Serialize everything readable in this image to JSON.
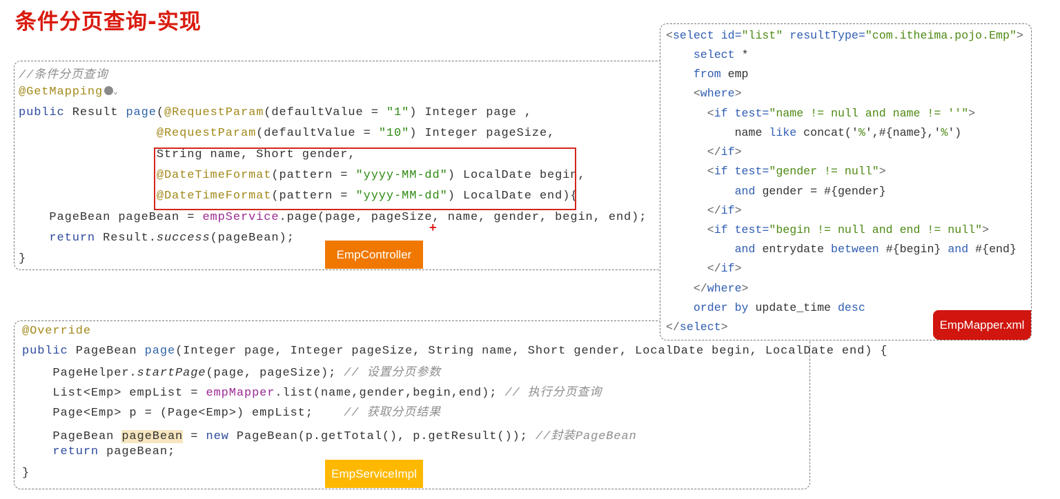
{
  "title": "条件分页查询-实现",
  "controller": {
    "label": "EmpController",
    "lines": [
      [
        [
          "//条件分页查询",
          "c"
        ]
      ],
      [
        [
          "@GetMapping",
          "a"
        ]
      ],
      [
        [
          "public ",
          "k"
        ],
        [
          "Result ",
          "t"
        ],
        [
          "page",
          "m"
        ],
        [
          "(",
          "t"
        ],
        [
          "@RequestParam",
          "a"
        ],
        [
          "(defaultValue = ",
          "t"
        ],
        [
          "\"1\"",
          "s"
        ],
        [
          ") Integer page ,",
          "t"
        ]
      ],
      [
        [
          "                  ",
          "t"
        ],
        [
          "@RequestParam",
          "a"
        ],
        [
          "(defaultValue = ",
          "t"
        ],
        [
          "\"10\"",
          "s"
        ],
        [
          ") Integer pageSize,",
          "t"
        ]
      ],
      [
        [
          "                  String name, Short gender,",
          "t"
        ]
      ],
      [
        [
          "                  ",
          "t"
        ],
        [
          "@DateTimeFormat",
          "a"
        ],
        [
          "(pattern = ",
          "t"
        ],
        [
          "\"yyyy-MM-dd\"",
          "s"
        ],
        [
          ") LocalDate begin,",
          "t"
        ]
      ],
      [
        [
          "                  ",
          "t"
        ],
        [
          "@DateTimeFormat",
          "a"
        ],
        [
          "(pattern = ",
          "t"
        ],
        [
          "\"yyyy-MM-dd\"",
          "s"
        ],
        [
          ") LocalDate end){",
          "t"
        ]
      ],
      [
        [
          "    PageBean pageBean = ",
          "t"
        ],
        [
          "empService",
          "f"
        ],
        [
          ".page(page, pageSize, name, gender, begin, end);",
          "t"
        ]
      ],
      [
        [
          "    ",
          "t"
        ],
        [
          "return ",
          "k"
        ],
        [
          "Result.",
          "t"
        ],
        [
          "success",
          "i"
        ],
        [
          "(pageBean);",
          "t"
        ]
      ],
      [
        [
          "}",
          "t"
        ]
      ]
    ]
  },
  "service": {
    "label": "EmpServiceImpl",
    "lines": [
      [
        [
          "@Override",
          "a"
        ]
      ],
      [
        [
          "public ",
          "k"
        ],
        [
          "PageBean ",
          "t"
        ],
        [
          "page",
          "m"
        ],
        [
          "(Integer page, Integer pageSize, String name, Short gender, LocalDate begin, LocalDate end) {",
          "t"
        ]
      ],
      [
        [
          "    PageHelper.",
          "t"
        ],
        [
          "startPage",
          "i"
        ],
        [
          "(page, pageSize); ",
          "t"
        ],
        [
          "// 设置分页参数",
          "c"
        ]
      ],
      [
        [
          "    List<Emp> empList = ",
          "t"
        ],
        [
          "empMapper",
          "f"
        ],
        [
          ".list(name,gender,begin,end); ",
          "t"
        ],
        [
          "// 执行分页查询",
          "c"
        ]
      ],
      [
        [
          "    Page<Emp> p = (Page<Emp>) empList;    ",
          "t"
        ],
        [
          "// 获取分页结果",
          "c"
        ]
      ],
      [
        [
          "    PageBean ",
          "t"
        ],
        [
          "pageBean",
          "h"
        ],
        [
          " = ",
          "t"
        ],
        [
          "new ",
          "k"
        ],
        [
          "PageBean(p.getTotal(), p.getResult()); ",
          "t"
        ],
        [
          "//封装PageBean",
          "c"
        ]
      ],
      [
        [
          "    ",
          "t"
        ],
        [
          "return ",
          "k"
        ],
        [
          "pageBean;",
          "t"
        ]
      ],
      [
        [
          "}",
          "t"
        ]
      ]
    ]
  },
  "mapper": {
    "label": "EmpMapper.xml",
    "lines": [
      [
        [
          "<",
          "tg"
        ],
        [
          "select ",
          "tn"
        ],
        [
          "id=",
          "an"
        ],
        [
          "\"list\" ",
          "av"
        ],
        [
          "resultType=",
          "an"
        ],
        [
          "\"com.itheima.pojo.Emp\"",
          "av"
        ],
        [
          ">",
          "tg"
        ]
      ],
      [
        [
          "    ",
          "t"
        ],
        [
          "select ",
          "kw"
        ],
        [
          "*",
          "t"
        ]
      ],
      [
        [
          "    ",
          "t"
        ],
        [
          "from ",
          "kw"
        ],
        [
          "emp",
          "t"
        ]
      ],
      [
        [
          "    <",
          "tg"
        ],
        [
          "where",
          "tn"
        ],
        [
          ">",
          "tg"
        ]
      ],
      [
        [
          "      <",
          "tg"
        ],
        [
          "if ",
          "tn"
        ],
        [
          "test=",
          "an"
        ],
        [
          "\"name != null and name != ''\"",
          "av"
        ],
        [
          ">",
          "tg"
        ]
      ],
      [
        [
          "          name ",
          "t"
        ],
        [
          "like ",
          "kw"
        ],
        [
          "concat('",
          "t"
        ],
        [
          "%",
          "av"
        ],
        [
          "',#{name},'",
          "t"
        ],
        [
          "%",
          "av"
        ],
        [
          "')",
          "t"
        ]
      ],
      [
        [
          "      </",
          "tg"
        ],
        [
          "if",
          "tn"
        ],
        [
          ">",
          "tg"
        ]
      ],
      [
        [
          "      <",
          "tg"
        ],
        [
          "if ",
          "tn"
        ],
        [
          "test=",
          "an"
        ],
        [
          "\"gender != null\"",
          "av"
        ],
        [
          ">",
          "tg"
        ]
      ],
      [
        [
          "          ",
          "t"
        ],
        [
          "and ",
          "kw"
        ],
        [
          "gender = #{gender}",
          "t"
        ]
      ],
      [
        [
          "      </",
          "tg"
        ],
        [
          "if",
          "tn"
        ],
        [
          ">",
          "tg"
        ]
      ],
      [
        [
          "      <",
          "tg"
        ],
        [
          "if ",
          "tn"
        ],
        [
          "test=",
          "an"
        ],
        [
          "\"begin != null and end != null\"",
          "av"
        ],
        [
          ">",
          "tg"
        ]
      ],
      [
        [
          "          ",
          "t"
        ],
        [
          "and ",
          "kw"
        ],
        [
          "entrydate ",
          "t"
        ],
        [
          "between ",
          "kw"
        ],
        [
          "#{begin} ",
          "t"
        ],
        [
          "and ",
          "kw"
        ],
        [
          "#{end}",
          "t"
        ]
      ],
      [
        [
          "      </",
          "tg"
        ],
        [
          "if",
          "tn"
        ],
        [
          ">",
          "tg"
        ]
      ],
      [
        [
          "    </",
          "tg"
        ],
        [
          "where",
          "tn"
        ],
        [
          ">",
          "tg"
        ]
      ],
      [
        [
          "    ",
          "t"
        ],
        [
          "order by ",
          "kw"
        ],
        [
          "update_time ",
          "t"
        ],
        [
          "desc",
          "kw"
        ]
      ],
      [
        [
          "</",
          "tg"
        ],
        [
          "select",
          "tn"
        ],
        [
          ">",
          "tg"
        ]
      ]
    ]
  },
  "colors": {
    "title": "#D91A0E",
    "controller_label": "#F07800",
    "service_label": "#FFB800",
    "mapper_label": "#D0160F"
  }
}
